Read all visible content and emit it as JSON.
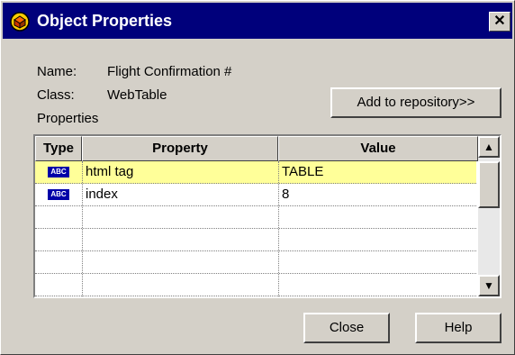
{
  "window": {
    "title": "Object Properties",
    "close_glyph": "✕"
  },
  "info": {
    "name_label": "Name:",
    "name_value": "Flight Confirmation #",
    "class_label": "Class:",
    "class_value": "WebTable",
    "properties_label": "Properties"
  },
  "add_button": "Add to repository>>",
  "table": {
    "columns": [
      "Type",
      "Property",
      "Value"
    ],
    "rows": [
      {
        "type_icon": "abc-string-icon",
        "type_badge": "ABC",
        "property": "html tag",
        "value": "TABLE",
        "selected": true
      },
      {
        "type_icon": "abc-string-icon",
        "type_badge": "ABC",
        "property": "index",
        "value": "8",
        "selected": false
      }
    ],
    "empty_rows": 4,
    "scroll_up": "▲",
    "scroll_down": "▼"
  },
  "footer": {
    "close_label": "Close",
    "help_label": "Help"
  },
  "colors": {
    "titlebar": "#00007b",
    "selection": "#ffff99",
    "badge": "#0000a8",
    "face": "#d4d0c8"
  }
}
